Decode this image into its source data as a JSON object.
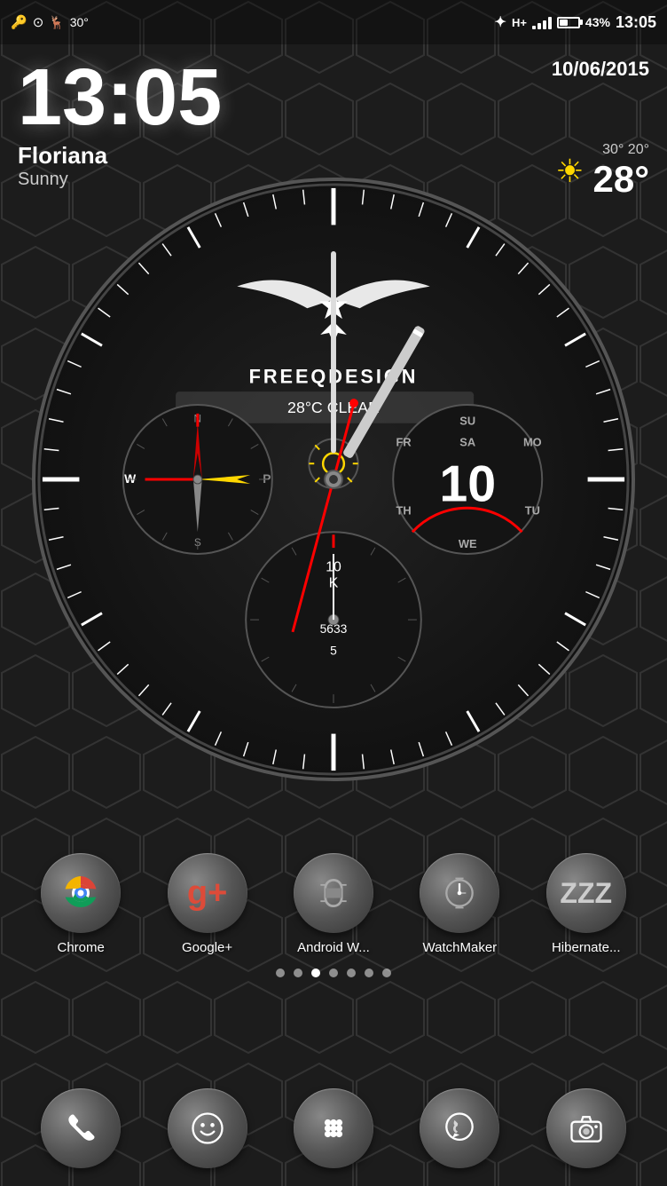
{
  "statusBar": {
    "time": "13:05",
    "battery": "43%",
    "date": "10/06/2015"
  },
  "clock": {
    "digitalTime": "13:05",
    "date": "10/06/2015"
  },
  "location": {
    "name": "Floriana",
    "condition": "Sunny"
  },
  "weather": {
    "highTemp": "30°",
    "lowTemp": "20°",
    "currentTemp": "28°",
    "description": "28°C CLEAR"
  },
  "watchBrand": "FREEQDESIGN",
  "subDialRight": {
    "dayNumber": "10",
    "days": [
      "SU",
      "MO",
      "TU",
      "WE",
      "TH",
      "FR",
      "SA"
    ]
  },
  "subDialBottom": {
    "labels": [
      "10",
      "K",
      "5633",
      "5"
    ]
  },
  "apps": [
    {
      "id": "chrome",
      "label": "Chrome",
      "icon": "chrome"
    },
    {
      "id": "googleplus",
      "label": "Google+",
      "icon": "g+"
    },
    {
      "id": "androidwear",
      "label": "Android W...",
      "icon": "watch"
    },
    {
      "id": "watchmaker",
      "label": "WatchMaker",
      "icon": "watchmaker"
    },
    {
      "id": "hibernate",
      "label": "Hibernate...",
      "icon": "zzz"
    }
  ],
  "pageDots": [
    1,
    2,
    3,
    4,
    5,
    6,
    7
  ],
  "activePageDot": 3,
  "bottomDock": [
    {
      "id": "phone",
      "label": "Phone",
      "icon": "phone"
    },
    {
      "id": "messages",
      "label": "Messages",
      "icon": "smiley"
    },
    {
      "id": "apps",
      "label": "Apps",
      "icon": "grid"
    },
    {
      "id": "whatsapp",
      "label": "WhatsApp",
      "icon": "whatsapp"
    },
    {
      "id": "camera",
      "label": "Camera",
      "icon": "camera"
    }
  ]
}
